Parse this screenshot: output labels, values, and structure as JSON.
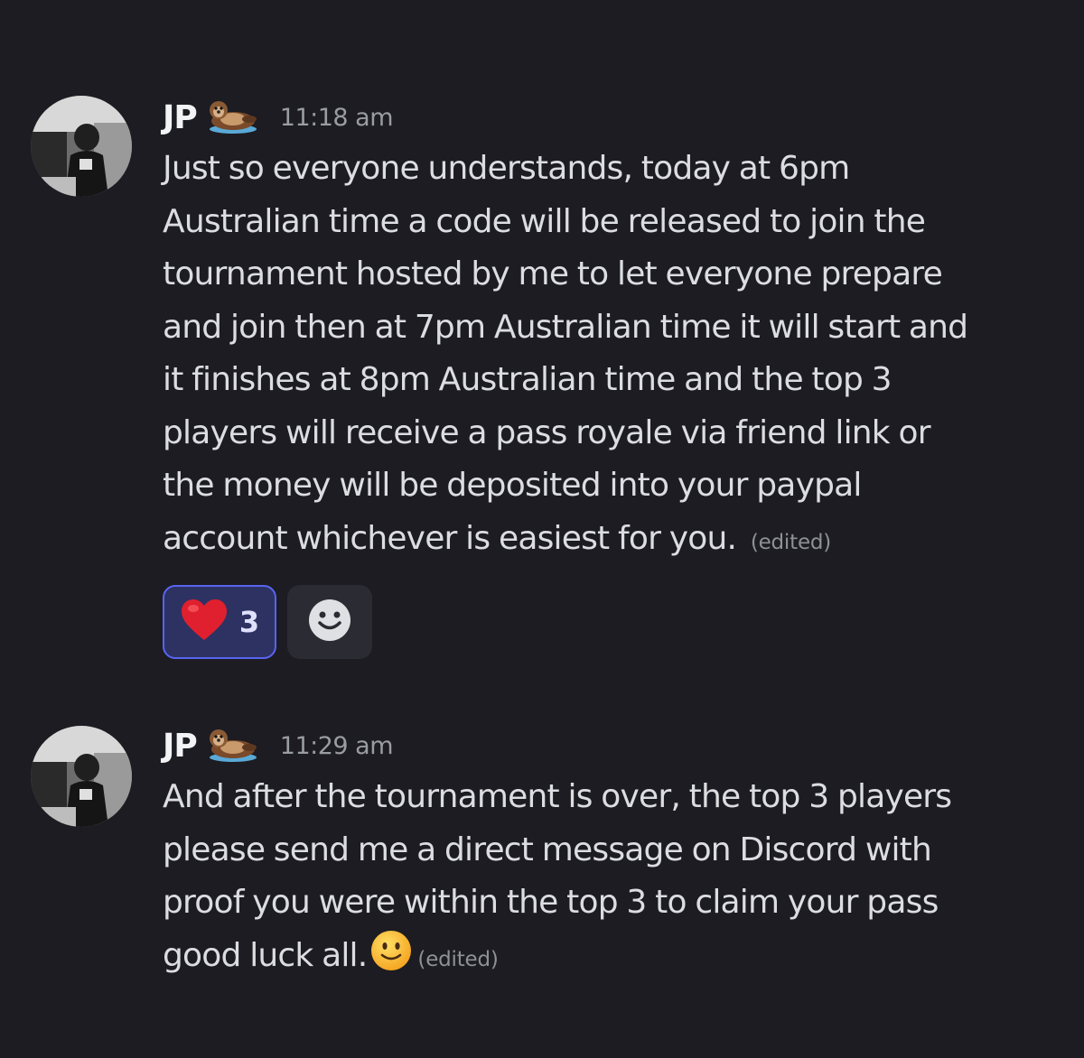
{
  "messages": [
    {
      "author": "JP",
      "badge_icon": "otter-emoji",
      "timestamp": "11:18 am",
      "lines": [
        "Just so everyone understands, today at 6pm",
        "Australian time a code will be released to join the",
        "tournament hosted by me to let everyone prepare",
        "and join then at 7pm Australian time it will start and",
        "it finishes at 8pm Australian time and the top 3",
        "players will receive a pass royale via friend link or",
        "the money will be deposited into your paypal",
        "account whichever is easiest for you."
      ],
      "edited_label": "(edited)",
      "reactions": [
        {
          "emoji": "heart-emoji",
          "count": "3",
          "active": true
        }
      ],
      "add_reaction_icon": "smiley-add-reaction-icon"
    },
    {
      "author": "JP",
      "badge_icon": "otter-emoji",
      "timestamp": "11:29 am",
      "lines": [
        "And after the tournament is over, the top 3 players",
        "please send me a direct message on Discord with",
        "proof you were within the top 3 to claim your pass",
        "good luck all."
      ],
      "trailing_emoji": "slightly-smiling-face-emoji",
      "edited_label": "(edited)"
    }
  ],
  "colors": {
    "background": "#1c1c22",
    "reaction_active_bg": "#2e3262",
    "reaction_active_border": "#5865f2",
    "add_reaction_bg": "#2b2c33"
  }
}
